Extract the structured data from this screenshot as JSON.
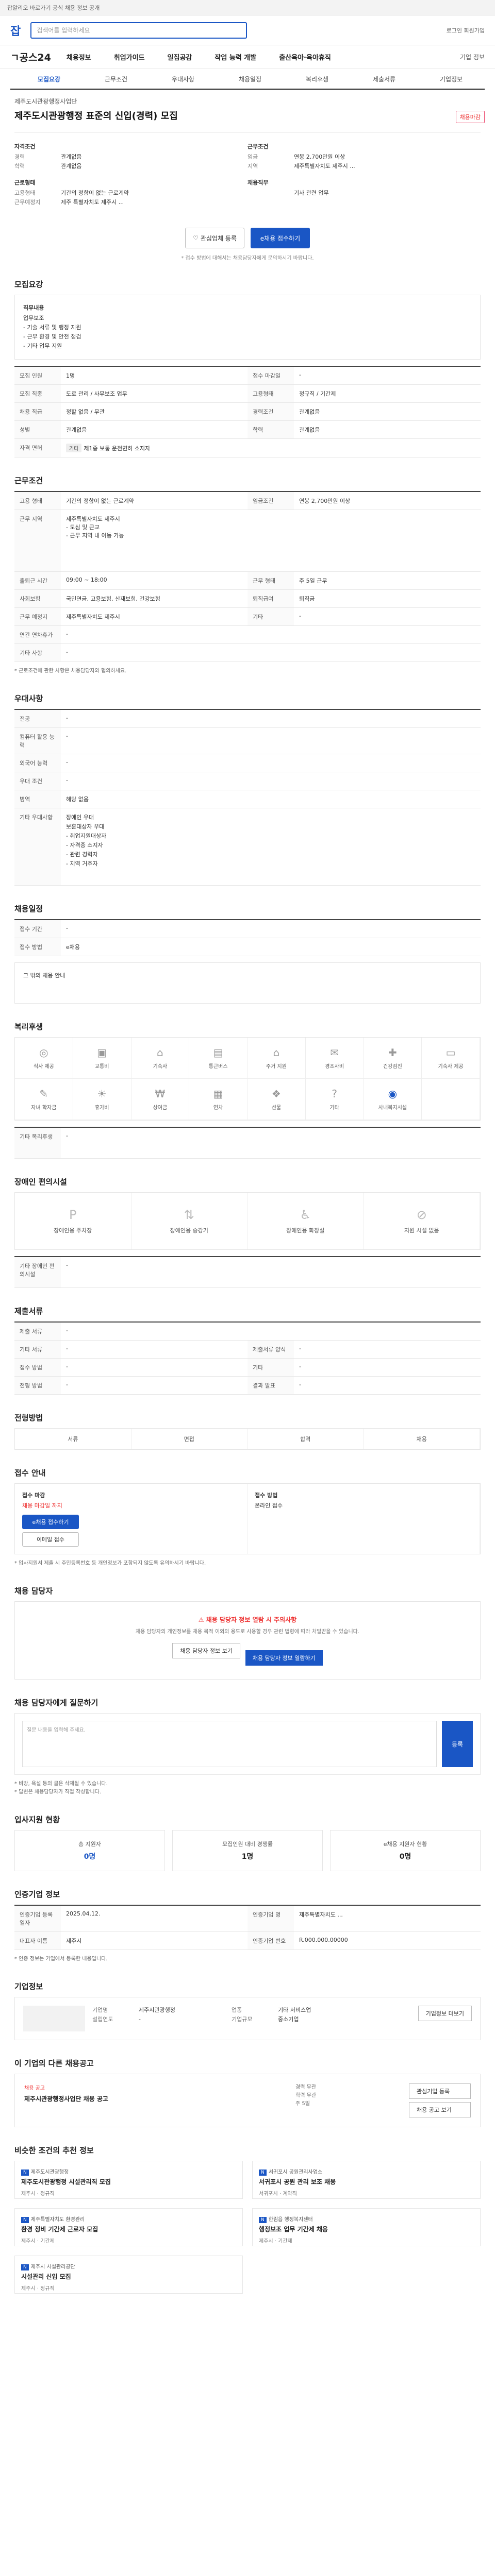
{
  "topbar": "잡알리오 바로가기 공식 채용 정보 공개",
  "header": {
    "logo": "잡",
    "search": "검색어를 입력하세요",
    "right": "로그인 회원가입"
  },
  "gnb": {
    "brand": "ㄱ공스24",
    "items": [
      "채용정보",
      "취업가이드",
      "일집공감",
      "작업 능력 개발",
      "출산육아·육아휴직"
    ],
    "right": "기업 정보"
  },
  "tabs": [
    "모집요강",
    "근무조건",
    "우대사항",
    "채용일정",
    "복리후생",
    "제출서류",
    "기업정보"
  ],
  "job": {
    "org": "제주도시관광행정사업단",
    "title": "제주도시관광행정 표준의 신입(경력) 모집",
    "badge": "채용마감"
  },
  "summary": {
    "left_h": "자격조건",
    "left": [
      [
        "경력",
        "관계없음"
      ],
      [
        "학력",
        "관계없음"
      ]
    ],
    "left_h2": "근로형태",
    "left2": [
      [
        "고용형태",
        "기간의 정함이 없는 근로계약"
      ],
      [
        "근무예정지",
        "제주 특별자치도 제주시 ..."
      ]
    ],
    "right_h": "근무조건",
    "right": [
      [
        "임금",
        "연봉 2,700만원 이상"
      ],
      [
        "지역",
        "제주특별자치도 제주시 ..."
      ]
    ],
    "right_h2": "채용직무",
    "right2": [
      [
        "",
        "기사 관련 업무"
      ]
    ]
  },
  "buttons": {
    "interest": "관심업체 등록",
    "apply": "e채용 접수하기"
  },
  "note": "* 접수 방법에 대해서는 채용담당자에게 문의하시기 바랍니다.",
  "s_recruit": {
    "title": "모집요강",
    "duty_head": "직무내용",
    "duties": [
      "업무보조",
      "- 기술 서류 및 행정 지원",
      "- 근무 환경 및 안전 점검",
      "- 기타 업무 지원"
    ],
    "rows": [
      [
        "모집 인원",
        "1명",
        "접수 마감일",
        "-"
      ],
      [
        "모집 직종",
        "도로 관리 / 사무보조 업무",
        "고용형태",
        "정규직 / 기간제"
      ],
      [
        "채용 직급",
        "정할 없음 / 무관",
        "경력조건",
        "관계없음"
      ],
      [
        "성별",
        "관계없음",
        "학력",
        "관계없음"
      ]
    ],
    "last_k": "자격 면허",
    "last_tag": "기타",
    "last_v": "제1종 보통 운전면허 소지자"
  },
  "s_cond": {
    "title": "근무조건",
    "rows": [
      [
        "고용 형태",
        "기간의 정함이 없는 근로계약",
        "임금조건",
        "연봉 2,700만원 이상"
      ]
    ],
    "loc_k": "근무 지역",
    "loc_v": [
      "제주특별자치도 제주시",
      "- 도심 및 근교",
      "- 근무 지역 내 이동 가능"
    ],
    "rows2": [
      [
        "출퇴근 시간",
        "09:00 ~ 18:00",
        "근무 형태",
        "주 5일 근무"
      ],
      [
        "사회보험",
        "국민연금, 고용보험, 산재보험, 건강보험",
        "퇴직급여",
        "퇴직금"
      ],
      [
        "근무 예정지",
        "제주특별자치도 제주시",
        "기타",
        "-"
      ]
    ],
    "rows3": [
      [
        "연간 연차휴가",
        "-"
      ],
      [
        "기타 사항",
        "-"
      ]
    ],
    "note": "* 근로조건에 관한 사항은 채용담당자와 협의하세요."
  },
  "s_pref": {
    "title": "우대사항",
    "rows": [
      [
        "전공",
        "-"
      ],
      [
        "컴퓨터 활용 능력",
        "-"
      ],
      [
        "외국어 능력",
        "-"
      ],
      [
        "우대 조건",
        "-"
      ],
      [
        "병역",
        "해당 없음"
      ]
    ],
    "etc_k": "기타 우대사항",
    "etc": [
      "장애인 우대",
      "보훈대상자 우대",
      "- 취업지원대상자",
      "- 자격증 소지자",
      "- 관련 경력자",
      "- 지역 거주자"
    ]
  },
  "s_date": {
    "title": "채용일정",
    "rows": [
      [
        "접수 기간",
        "-"
      ],
      [
        "접수 방법",
        "e채용"
      ]
    ],
    "extra": "그 밖의 채용 안내"
  },
  "s_benefit": {
    "title": "복리후생",
    "items": [
      "식사 제공",
      "교통비",
      "기숙사",
      "통근버스",
      "주거 지원",
      "경조사비",
      "건강검진",
      "기숙사 제공",
      "자녀 학자금",
      "휴가비",
      "상여금",
      "연차",
      "선물",
      "기타",
      "사내복지시설"
    ],
    "other_k": "기타 복리후생",
    "other_v": "-"
  },
  "s_welfare": {
    "title": "장애인 편의시설",
    "items": [
      "장애인용 주차장",
      "장애인용 승강기",
      "장애인용 화장실",
      "지원 시설 없음"
    ],
    "other_k": "기타 장애인 편의시설",
    "other_v": "-"
  },
  "s_docs": {
    "title": "제출서류",
    "rows": [
      [
        "제출 서류",
        "-",
        "",
        ""
      ],
      [
        "기타 서류",
        "-",
        "제출서류 양식",
        "-"
      ],
      [
        "접수 방법",
        "-",
        "기타",
        "-"
      ],
      [
        "전형 방법",
        "-",
        "결과 발표",
        "-"
      ]
    ]
  },
  "s_process": {
    "title": "전형방법",
    "steps": [
      "서류",
      "면접",
      "합격",
      "채용"
    ]
  },
  "s_apply": {
    "title": "접수 안내",
    "c1_h": "접수 마감",
    "c1": "채용 마감일 까지",
    "btn1": "e채용 접수하기",
    "btn2": "이메일 접수",
    "c2_h": "접수 방법",
    "c2": "온라인 접수",
    "note": "* 입사지원서 제출 시 주민등록번호 등 개인정보가 포함되지 않도록 유의하시기 바랍니다."
  },
  "s_inquiry": {
    "title": "채용 담당자",
    "head": "채용 담당자 정보 열람 시 주의사항",
    "desc": "채용 담당자의 개인정보를 채용 목적 이외의 용도로 사용할 경우 관련 법령에 따라 처벌받을 수 있습니다.",
    "b1": "채용 담당자 정보 보기",
    "b2": "채용 담당자 정보 열람하기"
  },
  "s_qa": {
    "title": "채용 담당자에게 질문하기",
    "placeholder": "질문 내용을 입력해 주세요.",
    "btn": "등록",
    "notes": [
      "* 비방, 욕설 등의 글은 삭제될 수 있습니다.",
      "* 답변은 채용담당자가 직접 작성합니다."
    ]
  },
  "s_stat": {
    "title": "입사지원 현황",
    "items": [
      [
        "총 지원자",
        "0명"
      ],
      [
        "모집인원 대비 경쟁률",
        "1명"
      ],
      [
        "e채용 지원자 현황",
        "0명"
      ]
    ]
  },
  "s_hire": {
    "title": "인증기업 정보",
    "rows": [
      [
        "인증기업 등록일자",
        "2025.04.12.",
        "인증기업 명",
        "제주특별자치도 ..."
      ],
      [
        "대표자 이름",
        "제주시",
        "인증기업 번호",
        "R.000.000.00000"
      ]
    ],
    "note": "* 인증 정보는 기업에서 등록한 내용입니다."
  },
  "s_company": {
    "title": "기업정보",
    "rows": [
      [
        "기업명",
        "제주시관광행정",
        "업종",
        "기타 서비스업"
      ],
      [
        "설립연도",
        "-",
        "기업규모",
        "중소기업"
      ]
    ],
    "btn": "기업정보 더보기"
  },
  "s_other": {
    "title": "이 기업의 다른 채용공고",
    "label": "채용 공고",
    "name": "제주시관광행정사업단 채용 공고",
    "info": [
      "경력 무관",
      "학력 무관",
      "주 5일"
    ],
    "side": [
      "관심기업 등록",
      "채용 공고 보기"
    ]
  },
  "s_similar": {
    "title": "비슷한 조건의 추천 정보",
    "cards": [
      {
        "o": "제주도시관광행정",
        "t": "제주도시관광행정 시설관리직 모집",
        "m": "제주시 · 정규직"
      },
      {
        "o": "서귀포시 공원관리사업소",
        "t": "서귀포시 공원 관리 보조 채용",
        "m": "서귀포시 · 계약직"
      },
      {
        "o": "제주특별자치도 환경관리",
        "t": "환경 정비 기간제 근로자 모집",
        "m": "제주시 · 기간제"
      },
      {
        "o": "한림읍 행정복지센터",
        "t": "행정보조 업무 기간제 채용",
        "m": "제주시 · 기간제"
      },
      {
        "o": "제주시 시설관리공단",
        "t": "시설관리 신입 모집",
        "m": "제주시 · 정규직"
      }
    ]
  }
}
